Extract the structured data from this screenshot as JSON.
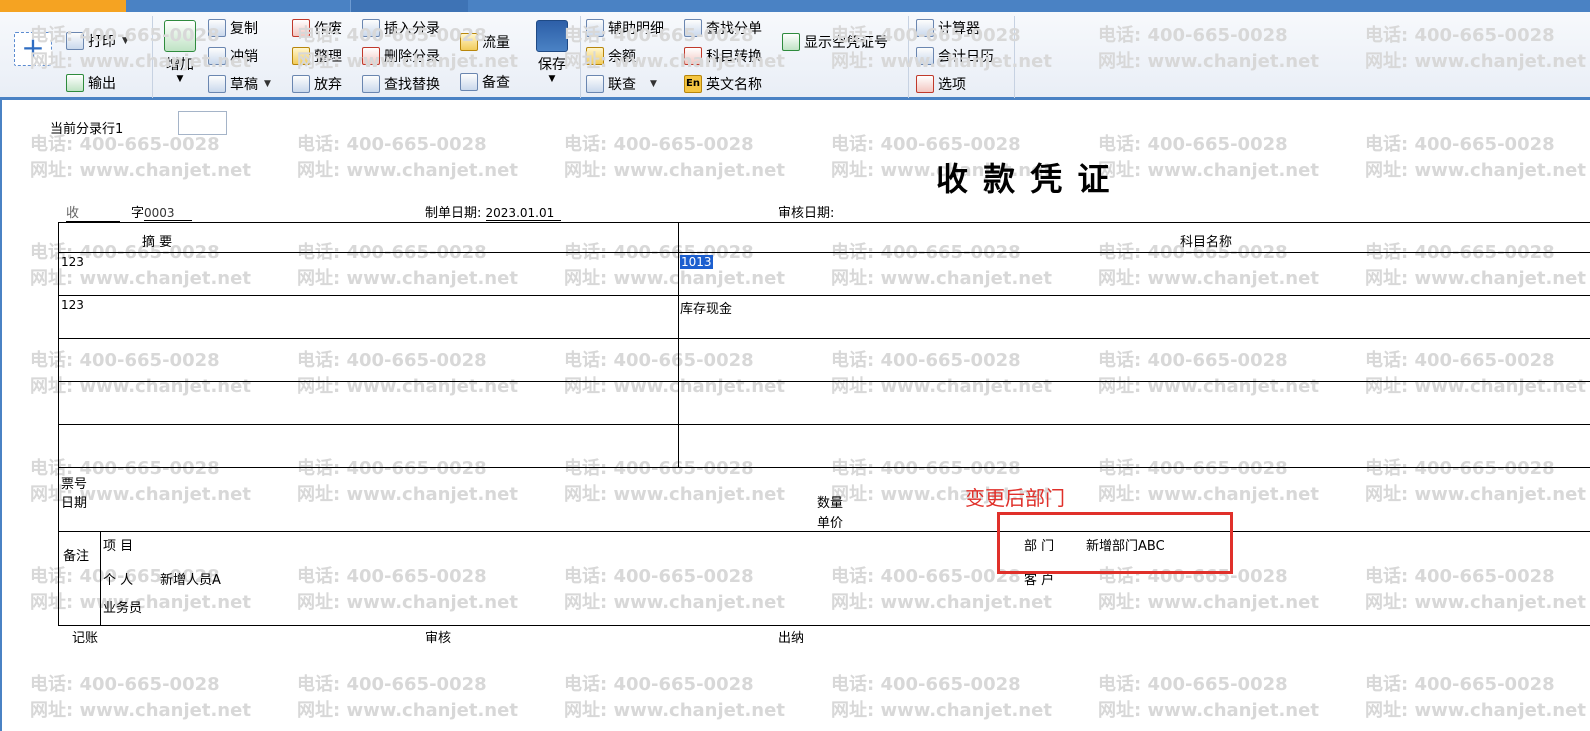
{
  "toolbar": {
    "add_plus": "+",
    "print": "打印",
    "export": "输出",
    "add": "增加",
    "copy": "复制",
    "reverse": "冲销",
    "draft": "草稿",
    "void": "作废",
    "arrange": "整理",
    "abandon": "放弃",
    "insert_entry": "插入分录",
    "delete_entry": "删除分录",
    "find_replace": "查找替换",
    "flow": "流量",
    "backup_check": "备查",
    "save": "保存",
    "aux_detail": "辅助明细",
    "balance": "余额",
    "linked_query": "联查",
    "find_entry": "查找分单",
    "account_convert": "科目转换",
    "english_name": "英文名称",
    "show_empty_no": "显示空凭证号",
    "calculator": "计算器",
    "accounting_calendar": "会计日历",
    "options": "选项"
  },
  "current_row": {
    "label": "当前分录行1"
  },
  "voucher": {
    "title": "收 款 凭 证",
    "type_char": "收",
    "zi_label": "字",
    "number": "0003",
    "make_date_label": "制单日期:",
    "make_date": "2023.01.01",
    "audit_date_label": "审核日期:",
    "col_summary": "摘 要",
    "col_account": "科目名称",
    "rows": [
      {
        "summary": "123",
        "account": "1013"
      },
      {
        "summary": "123",
        "account": "库存现金"
      },
      {
        "summary": "",
        "account": ""
      },
      {
        "summary": "",
        "account": ""
      },
      {
        "summary": "",
        "account": ""
      }
    ],
    "ticket_no": "票号",
    "date_label": "日期",
    "qty_label": "数量",
    "unit_price_label": "单价",
    "remark_label": "备注",
    "project_label": "项 目",
    "person_label": "个 人",
    "person_value": "新增人员A",
    "salesman_label": "业务员",
    "dept_label": "部 门",
    "dept_value": "新增部门ABC",
    "customer_label": "客 户",
    "bookkeeper_label": "记账",
    "auditor_label": "审核",
    "cashier_label": "出纳"
  },
  "annotation": {
    "text": "变更后部门",
    "color": "#e0302a"
  },
  "watermark": {
    "phone": "电话: 400-665-0028",
    "site": "网址: www.chanjet.net"
  },
  "colors": {
    "accent": "#4a82c4",
    "tab_orange": "#f5a322",
    "selection": "#1c5fcf"
  }
}
